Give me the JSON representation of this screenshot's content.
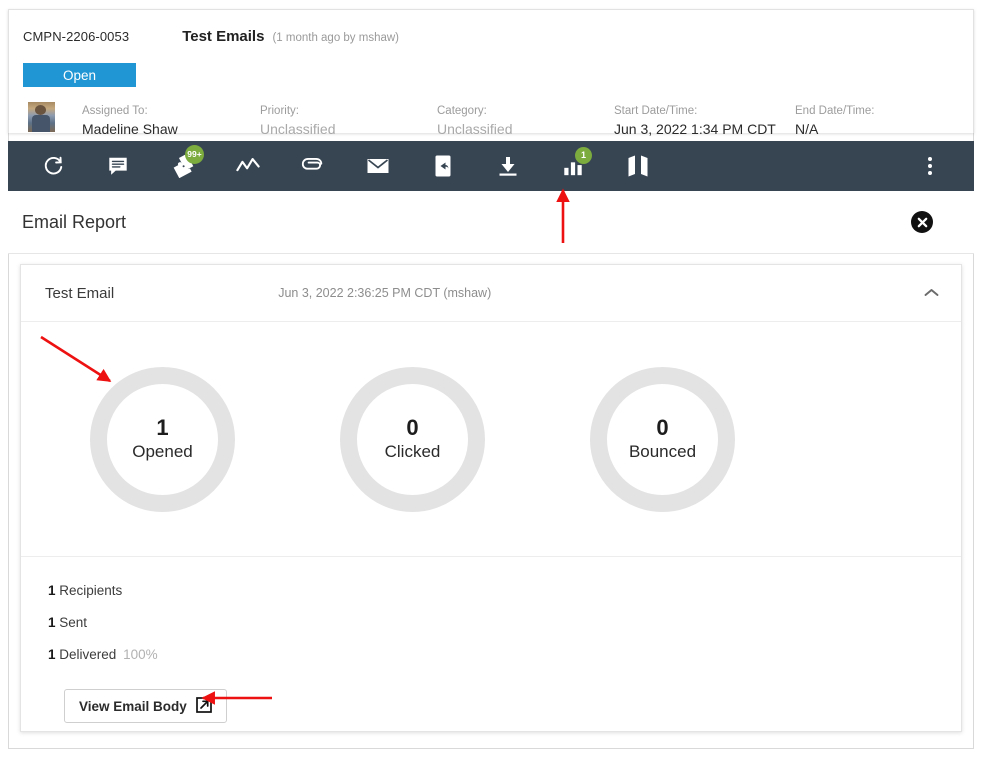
{
  "record": {
    "id": "CMPN-2206-0053",
    "title": "Test Emails",
    "meta": "(1 month ago by mshaw)",
    "status": "Open",
    "fields": [
      {
        "label": "Assigned To:",
        "value": "Madeline Shaw",
        "muted": false
      },
      {
        "label": "Priority:",
        "value": "Unclassified",
        "muted": true
      },
      {
        "label": "Category:",
        "value": "Unclassified",
        "muted": true
      },
      {
        "label": "Start Date/Time:",
        "value": "Jun 3, 2022 1:34 PM CDT",
        "muted": false
      },
      {
        "label": "End Date/Time:",
        "value": "N/A",
        "muted": false
      }
    ]
  },
  "toolbar": {
    "icons": [
      {
        "name": "refresh-icon",
        "badge": null
      },
      {
        "name": "comment-icon",
        "badge": null
      },
      {
        "name": "puzzle-icon",
        "badge": "99+"
      },
      {
        "name": "activity-icon",
        "badge": null
      },
      {
        "name": "paperclip-icon",
        "badge": null
      },
      {
        "name": "envelope-icon",
        "badge": null
      },
      {
        "name": "mobile-reply-icon",
        "badge": null
      },
      {
        "name": "download-icon",
        "badge": null
      },
      {
        "name": "bar-chart-icon",
        "badge": "1"
      },
      {
        "name": "map-icon",
        "badge": null
      }
    ],
    "overflow_name": "more-options-icon",
    "badge_color": "#7cab3e",
    "background": "#374553"
  },
  "panel": {
    "title": "Email Report",
    "close_label": "close"
  },
  "report": {
    "subject": "Test Email",
    "timestamp": "Jun 3, 2022 2:36:25 PM CDT (mshaw)",
    "donuts": [
      {
        "value": "1",
        "label": "Opened"
      },
      {
        "value": "0",
        "label": "Clicked"
      },
      {
        "value": "0",
        "label": "Bounced"
      }
    ],
    "stats": [
      {
        "count": "1",
        "label": "Recipients",
        "pct": ""
      },
      {
        "count": "1",
        "label": "Sent",
        "pct": ""
      },
      {
        "count": "1",
        "label": "Delivered",
        "pct": "100%"
      }
    ],
    "view_button": "View Email Body",
    "ring_color": "#e3e3e3"
  },
  "annotations": {
    "arrow_color": "#ee1111",
    "arrows": [
      {
        "name": "arrow-to-chart-icon"
      },
      {
        "name": "arrow-to-opened-donut"
      },
      {
        "name": "arrow-to-view-email-body"
      }
    ]
  }
}
